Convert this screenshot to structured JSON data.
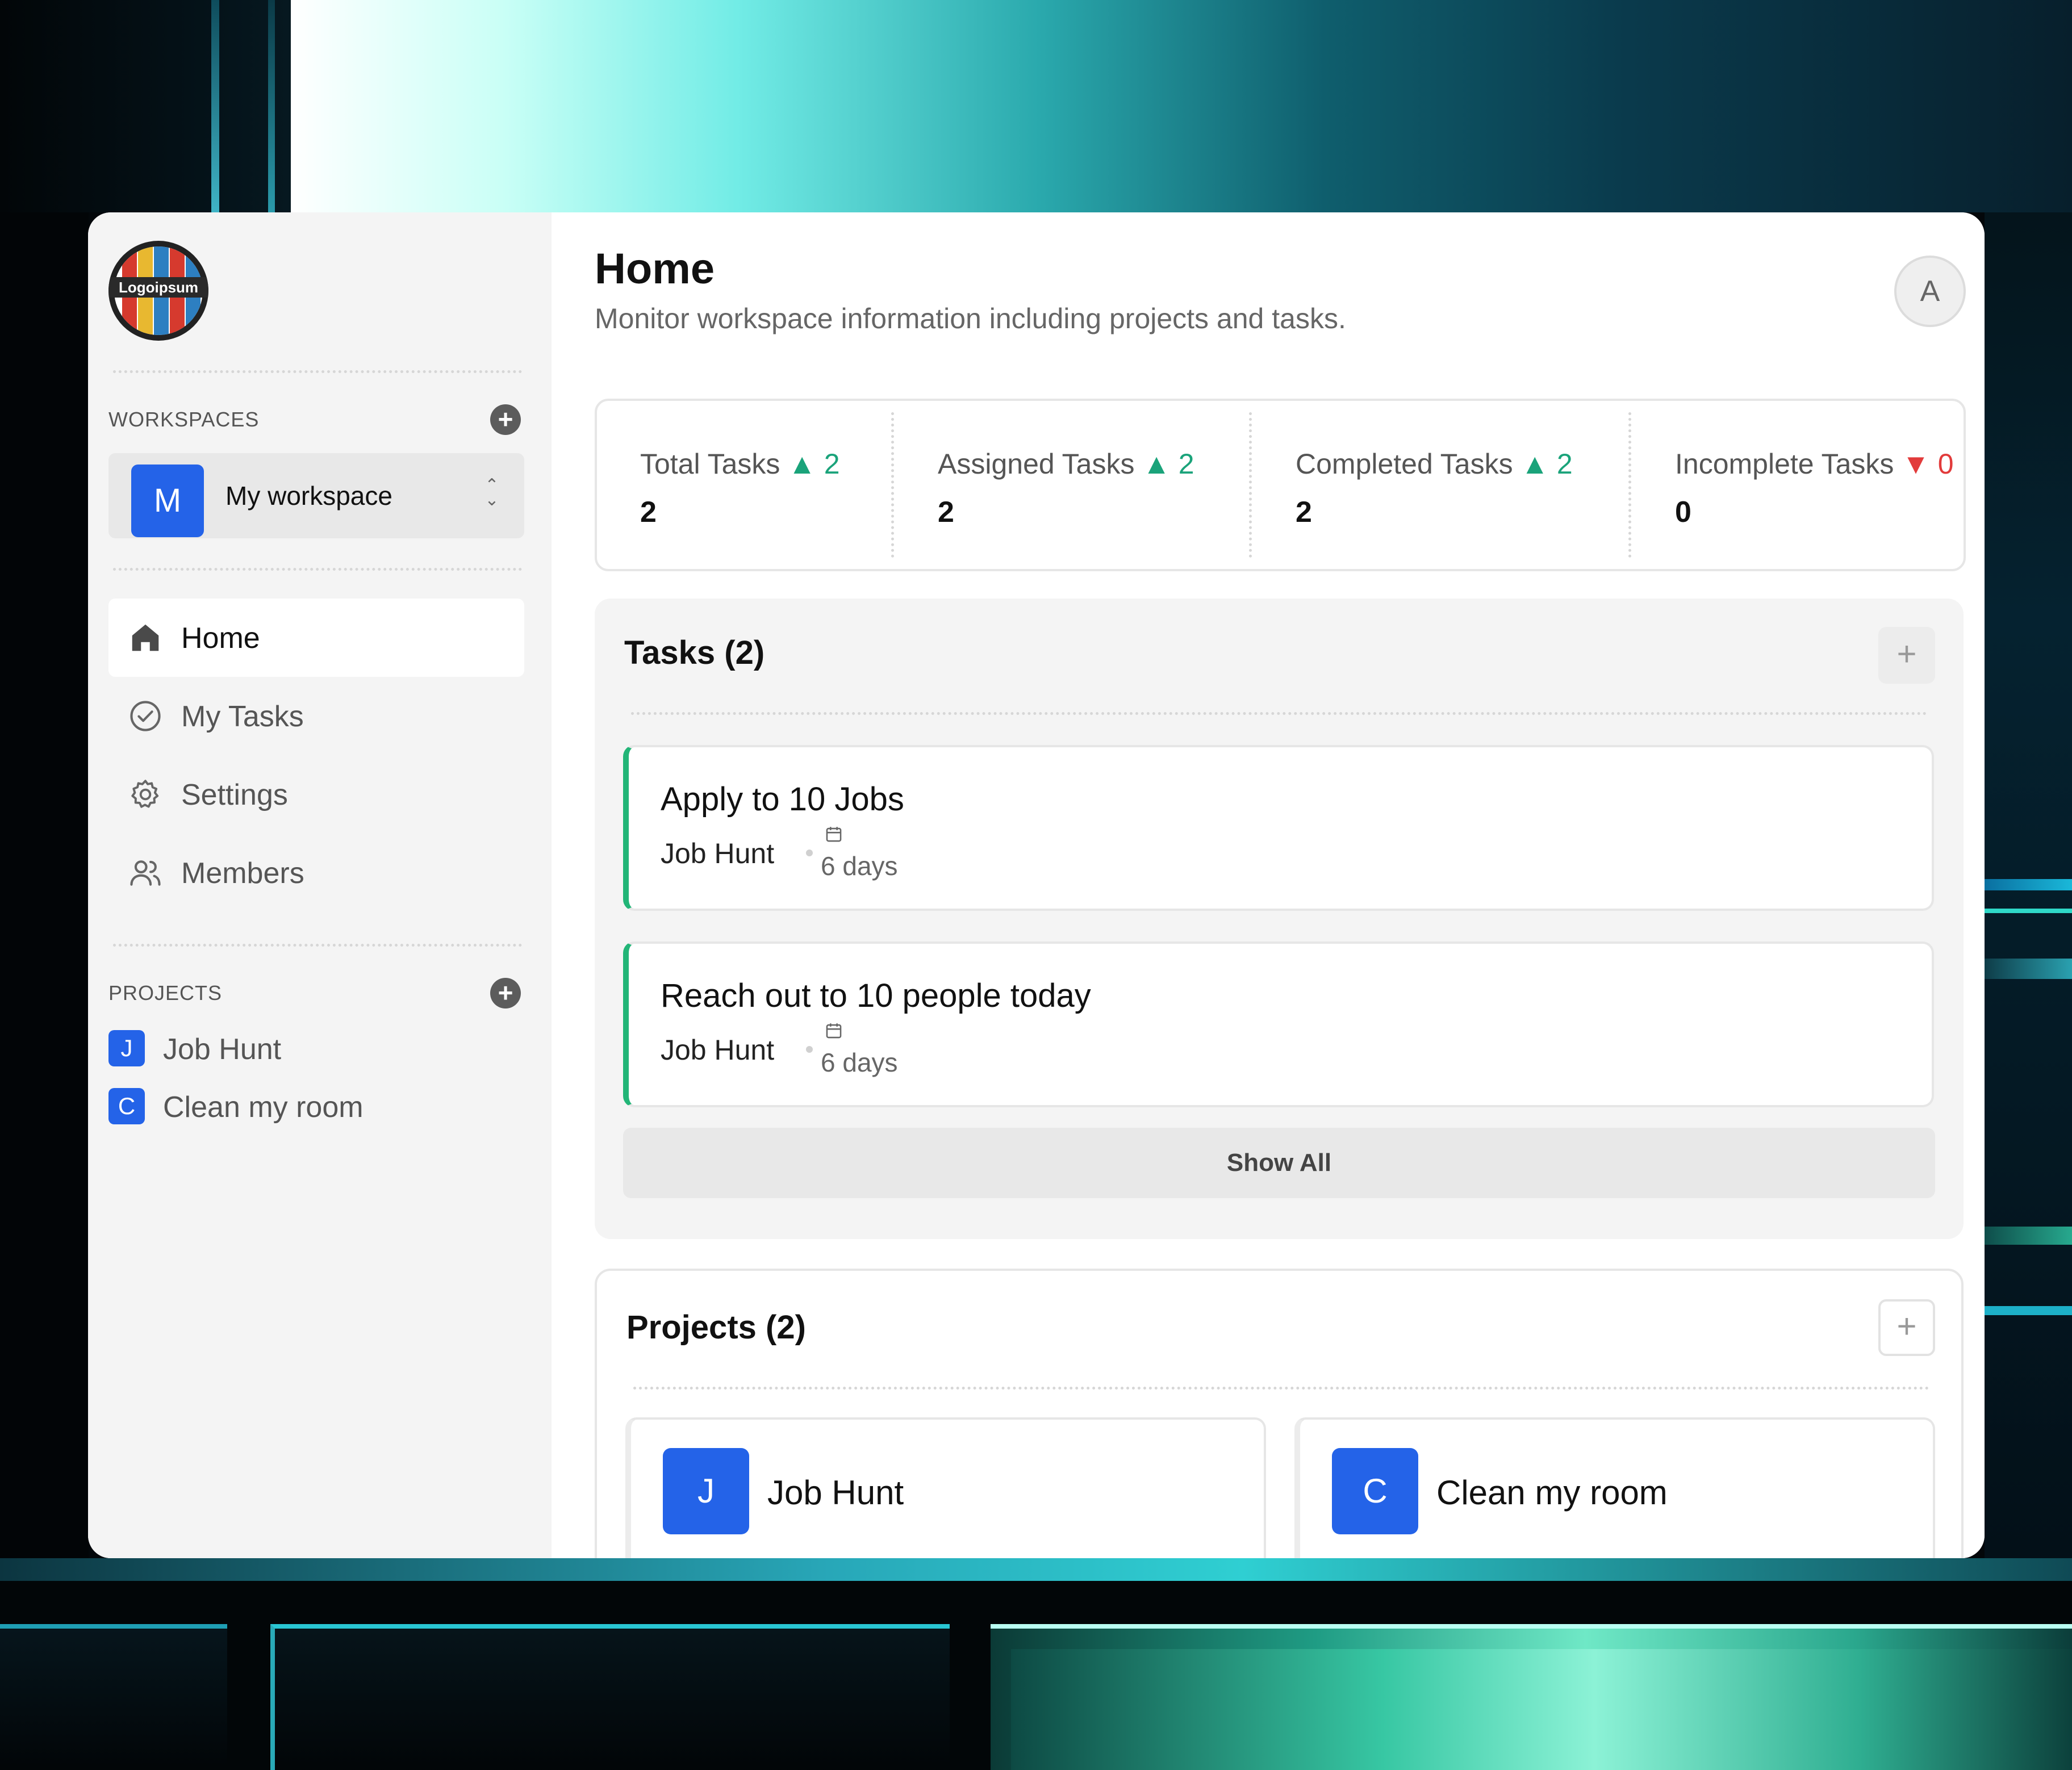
{
  "logo": {
    "text": "Logoipsum",
    "colors": [
      "#d63a2e",
      "#e8b830",
      "#2d7fc1",
      "#3a9e56"
    ]
  },
  "sidebar": {
    "workspaces_label": "WORKSPACES",
    "workspace": {
      "initial": "M",
      "name": "My workspace"
    },
    "nav": [
      {
        "label": "Home",
        "icon": "home-icon",
        "active": true
      },
      {
        "label": "My Tasks",
        "icon": "check-circle-icon",
        "active": false
      },
      {
        "label": "Settings",
        "icon": "gear-icon",
        "active": false
      },
      {
        "label": "Members",
        "icon": "users-icon",
        "active": false
      }
    ],
    "projects_label": "PROJECTS",
    "projects": [
      {
        "initial": "J",
        "name": "Job Hunt"
      },
      {
        "initial": "C",
        "name": "Clean my room"
      }
    ]
  },
  "header": {
    "title": "Home",
    "subtitle": "Monitor workspace information including projects and tasks.",
    "user_initial": "A"
  },
  "stats": [
    {
      "label": "Total Tasks",
      "trend": "up",
      "change": "2",
      "value": "2"
    },
    {
      "label": "Assigned Tasks",
      "trend": "up",
      "change": "2",
      "value": "2"
    },
    {
      "label": "Completed Tasks",
      "trend": "up",
      "change": "2",
      "value": "2"
    },
    {
      "label": "Incomplete Tasks",
      "trend": "down",
      "change": "0",
      "value": "0"
    }
  ],
  "tasks": {
    "title": "Tasks (2)",
    "items": [
      {
        "title": "Apply to 10 Jobs",
        "project": "Job Hunt",
        "due": "6 days"
      },
      {
        "title": "Reach out to 10 people today",
        "project": "Job Hunt",
        "due": "6 days"
      }
    ],
    "show_all_label": "Show All"
  },
  "projects": {
    "title": "Projects (2)",
    "items": [
      {
        "initial": "J",
        "name": "Job Hunt"
      },
      {
        "initial": "C",
        "name": "Clean my room"
      }
    ]
  },
  "colors": {
    "accent": "#2463e8",
    "trend_up": "#1aa37a",
    "trend_down": "#e23b3b",
    "task_border": "#22b577"
  }
}
